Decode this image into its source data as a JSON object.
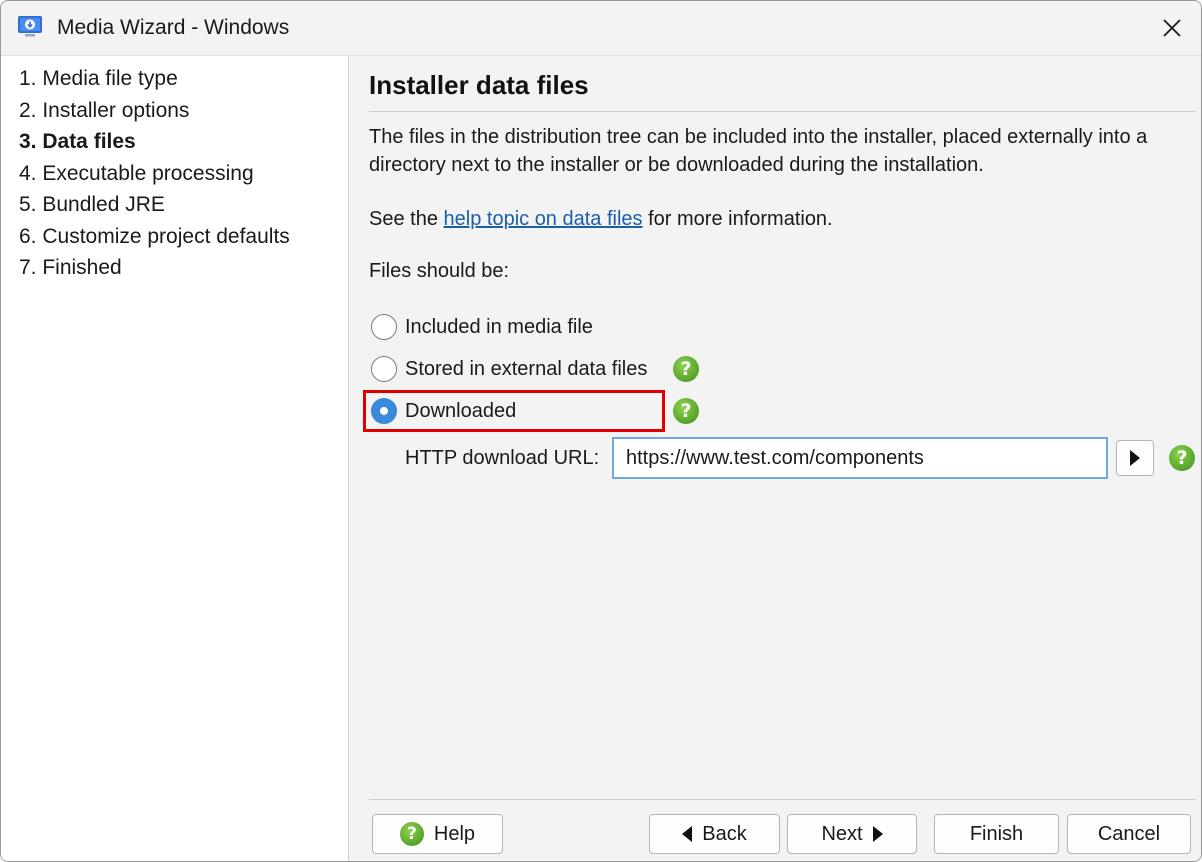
{
  "window": {
    "title": "Media Wizard - Windows",
    "app_icon": "media-wizard-icon",
    "close_icon": "close-icon"
  },
  "steps": [
    {
      "label": "1. Media file type",
      "active": false
    },
    {
      "label": "2. Installer options",
      "active": false
    },
    {
      "label": "3. Data files",
      "active": true
    },
    {
      "label": "4. Executable processing",
      "active": false
    },
    {
      "label": "5. Bundled JRE",
      "active": false
    },
    {
      "label": "6. Customize project defaults",
      "active": false
    },
    {
      "label": "7. Finished",
      "active": false
    }
  ],
  "main": {
    "heading": "Installer data files",
    "description": "The files in the distribution tree can be included into the installer, placed externally into a directory next to the installer or be downloaded during the installation.",
    "see_prefix": "See the ",
    "help_link": "help topic on data files",
    "see_suffix": " for more information.",
    "files_label": "Files should be:",
    "options": [
      {
        "label": "Included in media file",
        "selected": false
      },
      {
        "label": "Stored in external data files",
        "selected": false
      },
      {
        "label": "Downloaded",
        "selected": true
      }
    ],
    "url_label": "HTTP download URL:",
    "url_value": "https://www.test.com/components"
  },
  "buttons": {
    "help": "Help",
    "back": "Back",
    "next": "Next",
    "finish": "Finish",
    "cancel": "Cancel"
  },
  "colors": {
    "selected_radio": "#3b8ad9",
    "highlight": "#e00000",
    "help_icon": "#4fa321",
    "link": "#1a5fa8"
  }
}
